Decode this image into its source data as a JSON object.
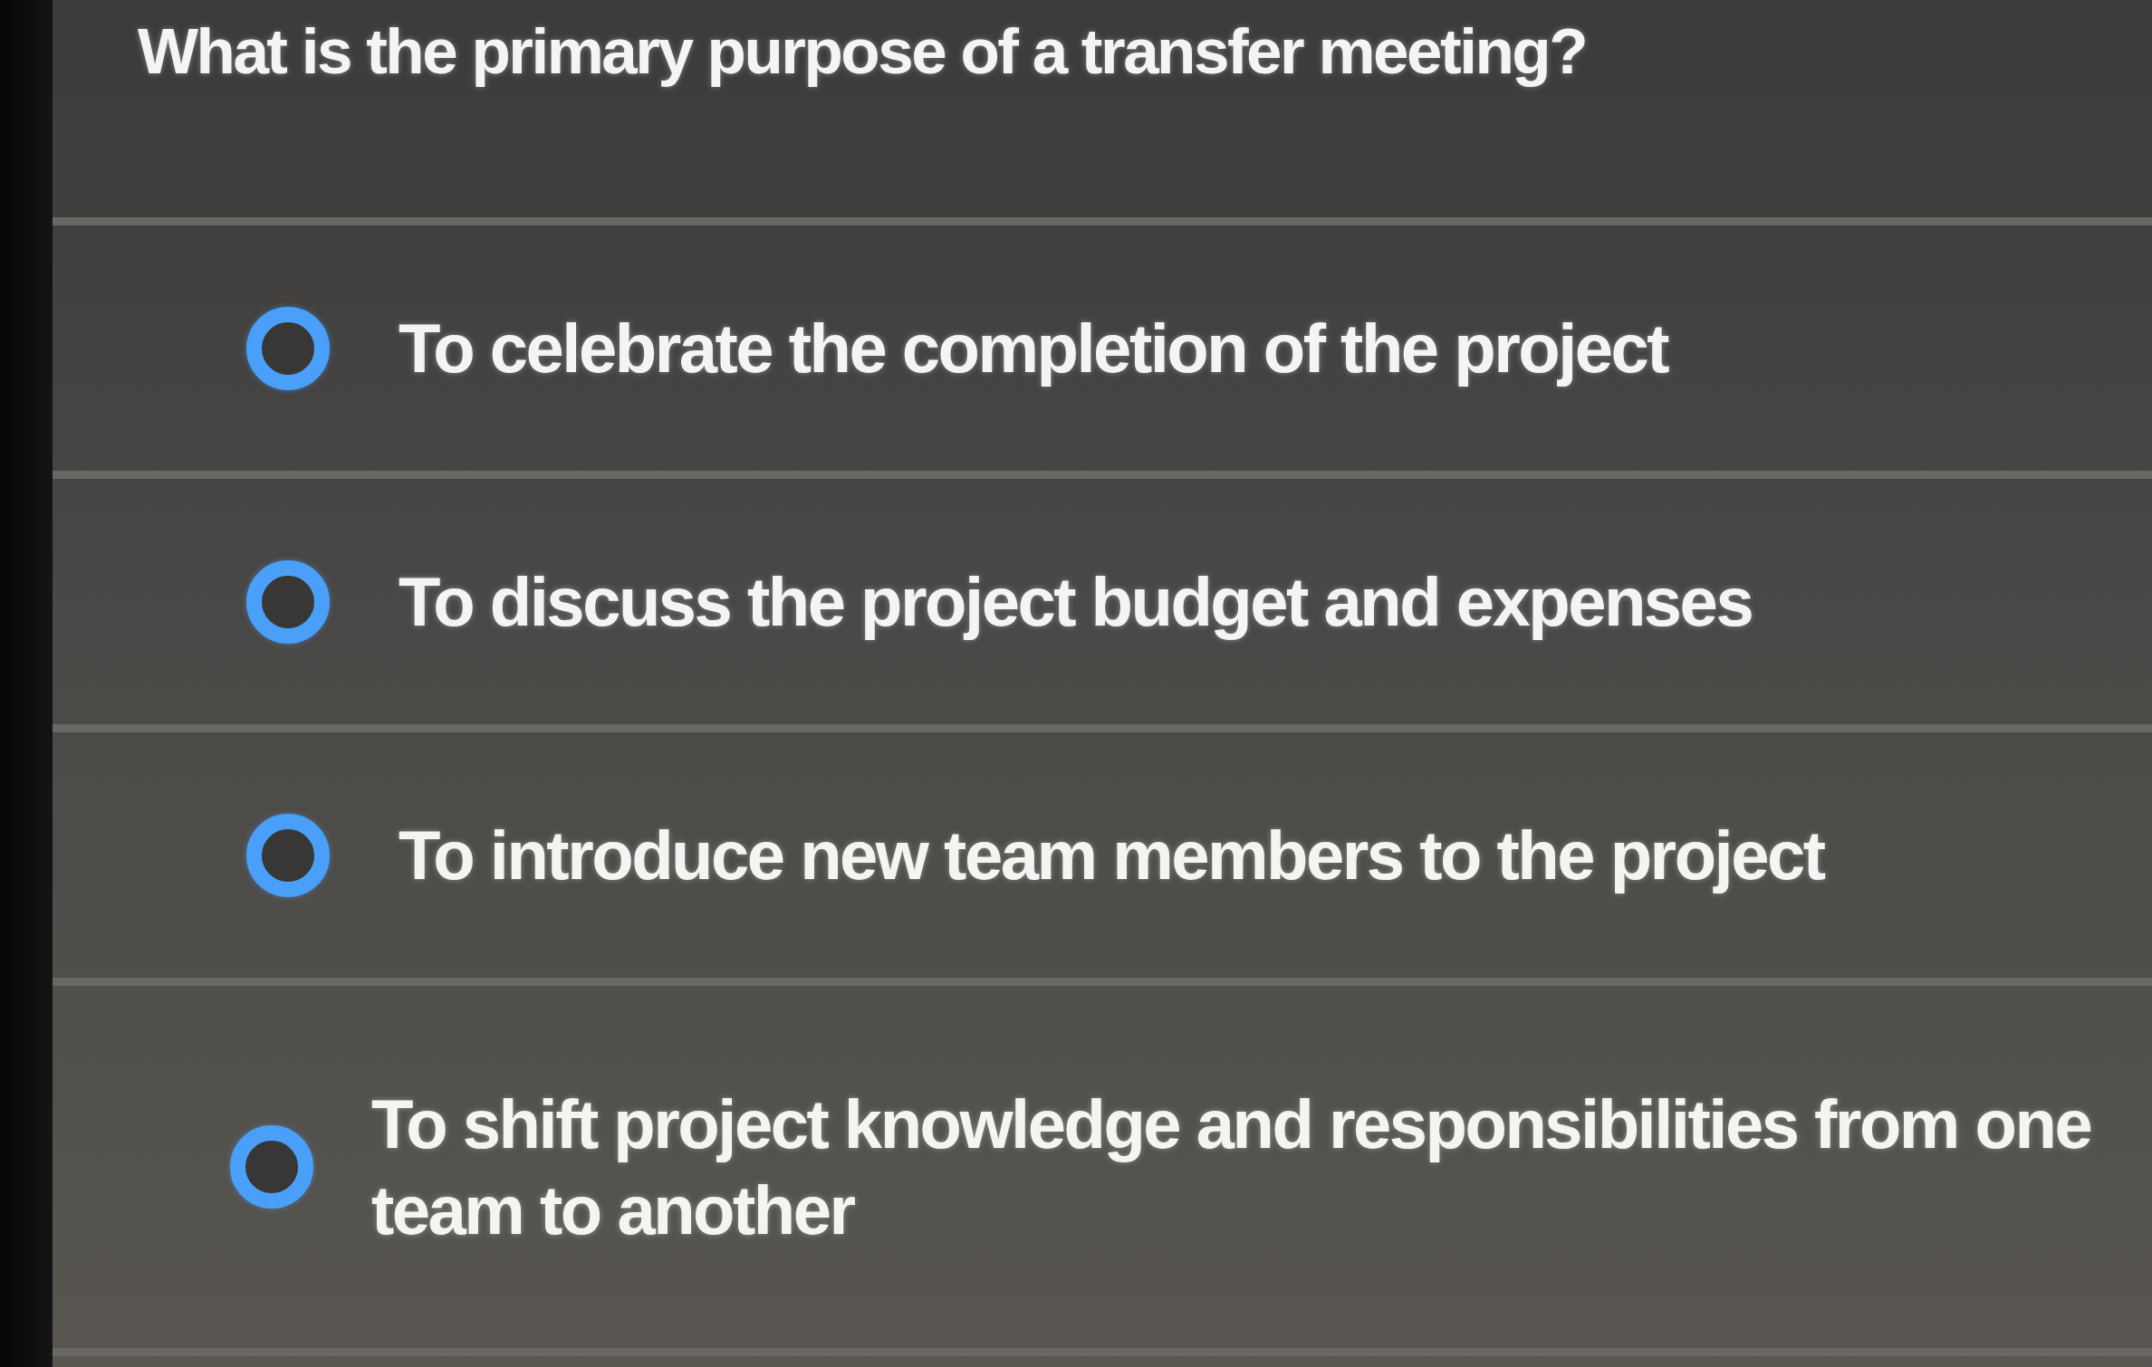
{
  "question": {
    "text": "What is the primary purpose of a transfer meeting?"
  },
  "options": [
    {
      "label": "To celebrate the completion of the project",
      "selected": false
    },
    {
      "label": "To discuss the project budget and expenses",
      "selected": false
    },
    {
      "label": "To introduce new team members to the project",
      "selected": false
    },
    {
      "label": "To shift project knowledge and responsibilities from one team to another",
      "selected": false
    }
  ]
}
